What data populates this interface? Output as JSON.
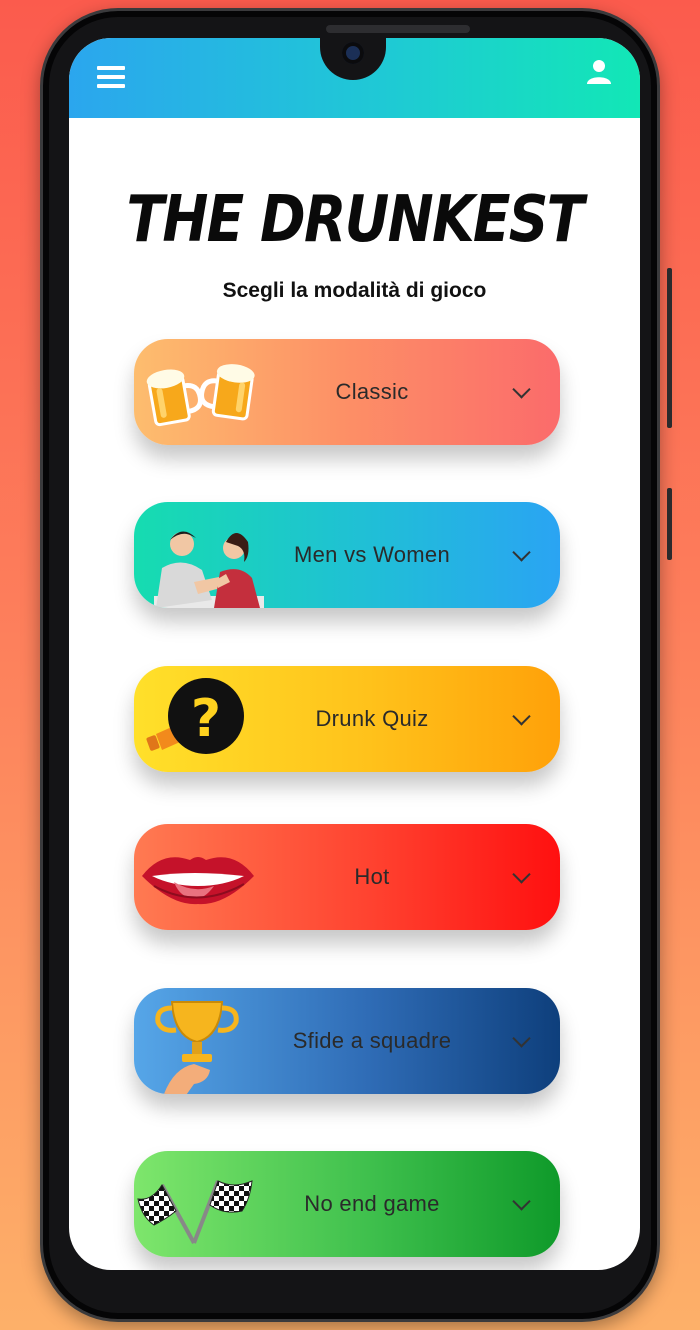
{
  "app": {
    "title": "THE DRUNKEST",
    "subtitle": "Scegli la modalità di gioco"
  },
  "appbar": {
    "menu_icon": "hamburger-menu-icon",
    "profile_icon": "user-icon",
    "gradient": [
      "#2ba6ee",
      "#12e7b6"
    ]
  },
  "modes": [
    {
      "label": "Classic",
      "icon": "beer-mugs-icon",
      "colors": [
        "#fdbd6e",
        "#fb6b6b"
      ]
    },
    {
      "label": "Men vs Women",
      "icon": "arm-wrestling-icon",
      "colors": [
        "#16dcb0",
        "#2aa4f3"
      ]
    },
    {
      "label": "Drunk Quiz",
      "icon": "question-megaphone-icon",
      "colors": [
        "#ffe02a",
        "#ffa109"
      ]
    },
    {
      "label": "Hot",
      "icon": "lips-icon",
      "colors": [
        "#ff7a52",
        "#ff1010"
      ]
    },
    {
      "label": "Sfide a squadre",
      "icon": "trophy-icon",
      "colors": [
        "#56a6e8",
        "#0e3f7c"
      ]
    },
    {
      "label": "No end game",
      "icon": "checkered-flags-icon",
      "colors": [
        "#7ee66c",
        "#0f9a2a"
      ]
    }
  ]
}
